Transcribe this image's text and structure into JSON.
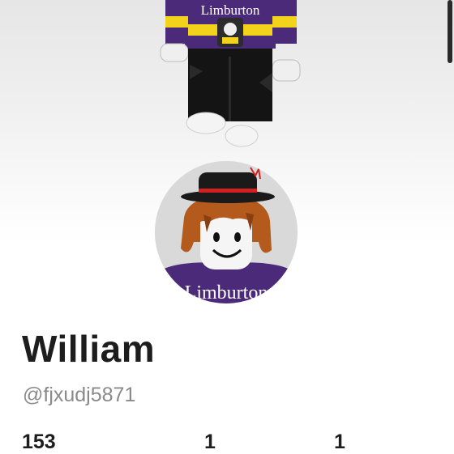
{
  "profile": {
    "display_name": "William",
    "username": "@fjxudj5871",
    "shirt_text": "Limburton"
  },
  "stats": [
    {
      "value": "153"
    },
    {
      "value": "1"
    },
    {
      "value": "1"
    }
  ],
  "colors": {
    "shirt_purple": "#4b2a7a",
    "shirt_yellow": "#f2d21b",
    "hair": "#b35a1c",
    "hat": "#1a1a1a",
    "hat_band": "#d32020"
  },
  "icons": {
    "avatar": "avatar-headshot",
    "full_body": "avatar-full-body"
  }
}
